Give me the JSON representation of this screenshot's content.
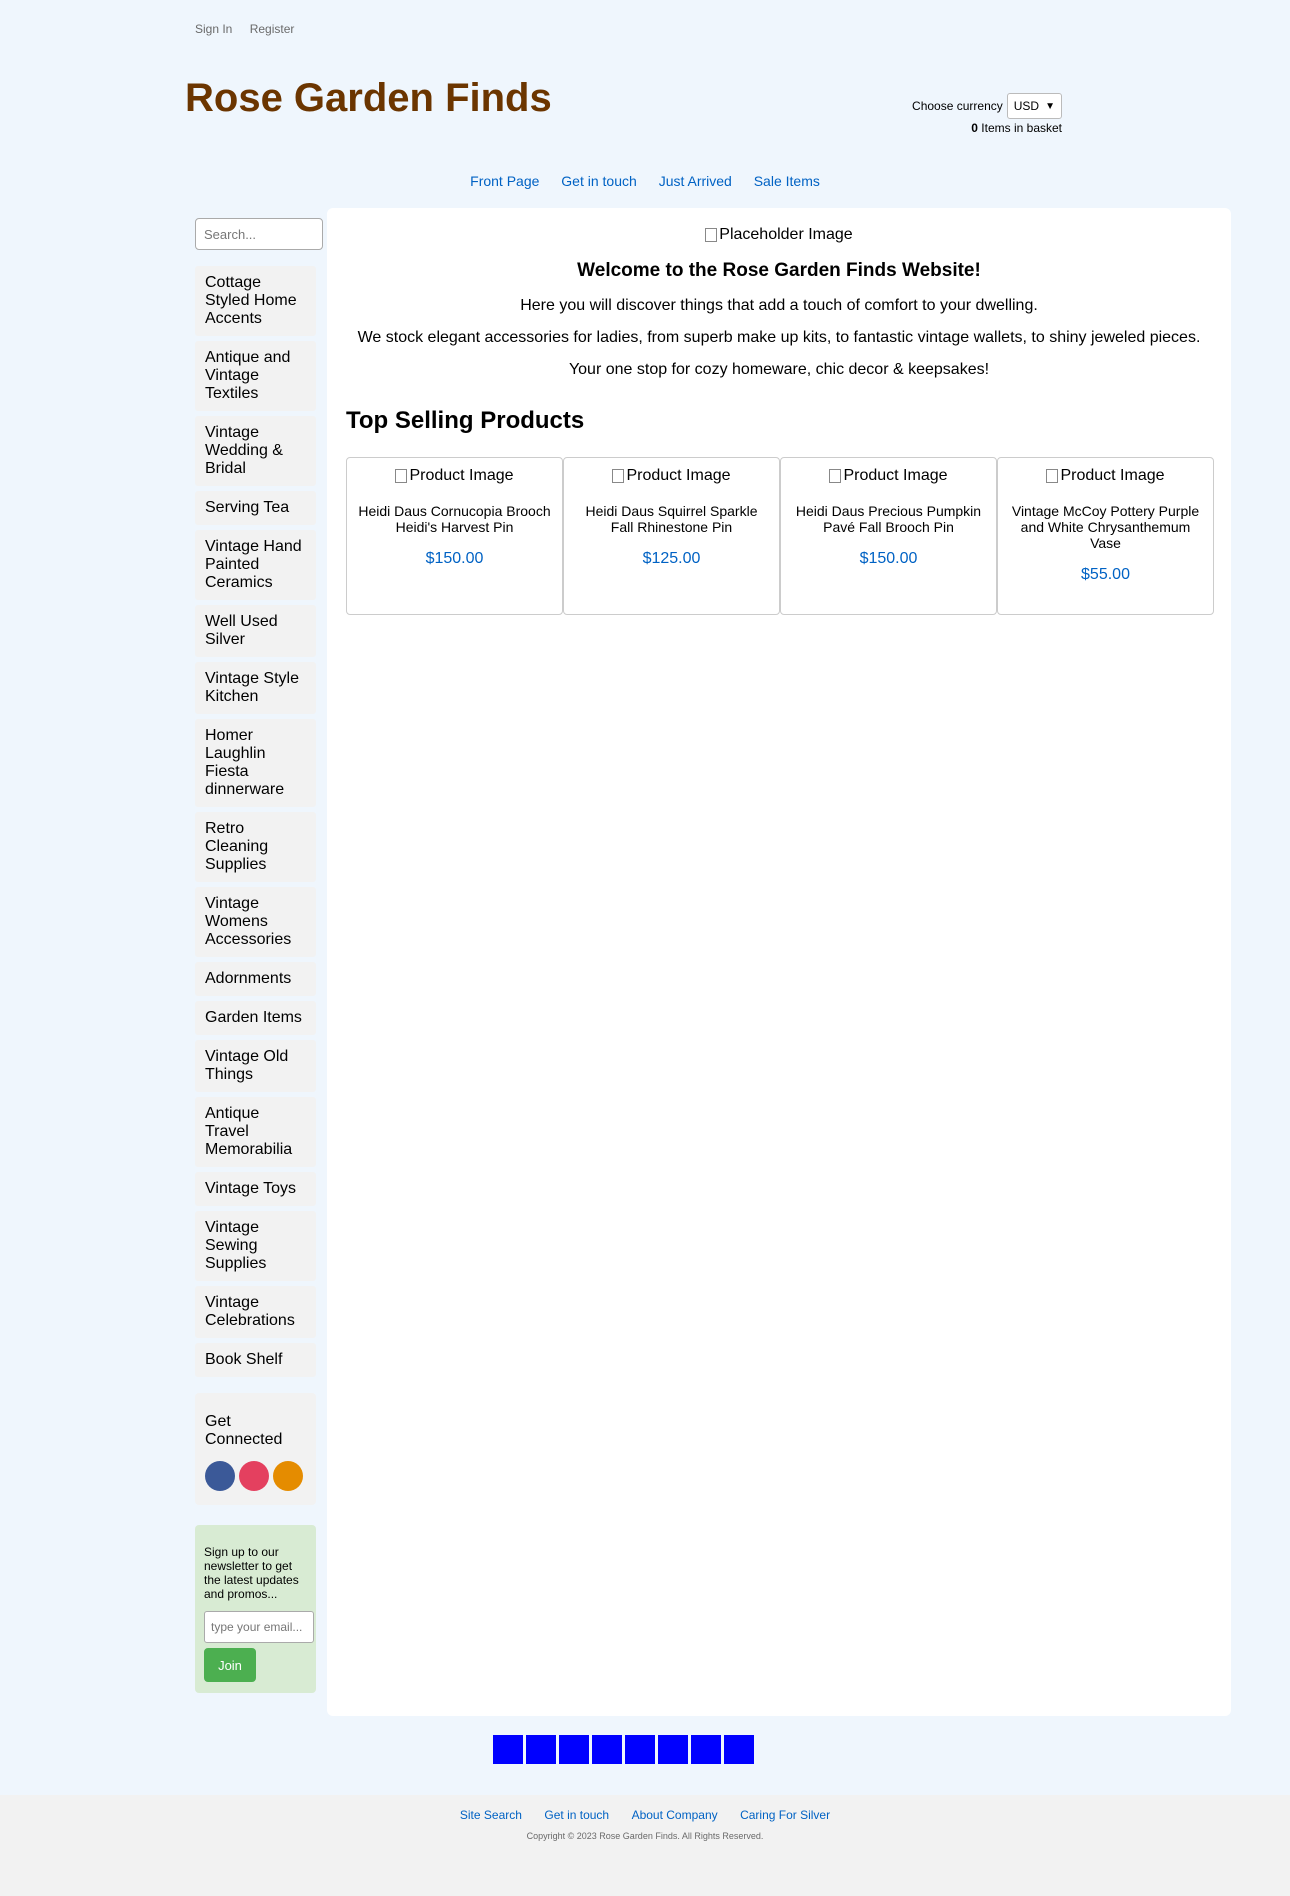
{
  "top_links": {
    "sign_in": "Sign In",
    "register": "Register"
  },
  "site": {
    "title": "Rose Garden Finds",
    "title_color": "#6b3500"
  },
  "currency": {
    "label": "Choose currency",
    "selected": "USD",
    "basket_count": "0",
    "basket_text": "Items in basket"
  },
  "nav": [
    "Front Page",
    "Get in touch",
    "Just Arrived",
    "Sale Items"
  ],
  "search": {
    "placeholder": "Search..."
  },
  "categories": [
    "Cottage Styled Home Accents",
    "Antique and Vintage Textiles",
    "Vintage Wedding & Bridal",
    "Serving Tea",
    "Vintage Hand Painted Ceramics",
    "Well Used Silver",
    "Vintage Style Kitchen",
    "Homer Laughlin Fiesta dinnerware",
    "Retro Cleaning Supplies",
    "Vintage Womens Accessories",
    "Adornments",
    "Garden Items",
    "Vintage Old Things",
    "Antique Travel Memorabilia",
    "Vintage Toys",
    "Vintage Sewing Supplies",
    "Vintage Celebrations",
    "Book Shelf"
  ],
  "connect": {
    "title": "Get Connected",
    "icons": [
      {
        "name": "facebook-icon",
        "color": "#3b5998"
      },
      {
        "name": "instagram-icon",
        "color": "#e4405f"
      },
      {
        "name": "rss-icon",
        "color": "#e58c00"
      }
    ]
  },
  "newsletter": {
    "text": "Sign up to our newsletter to get the latest updates and promos...",
    "placeholder": "type your email...",
    "button": "Join"
  },
  "main": {
    "hero_alt": "Placeholder Image",
    "welcome": "Welcome to the Rose Garden Finds Website!",
    "line1": "Here you will discover things that add a touch of comfort to your dwelling.",
    "line2": "We stock elegant accessories for ladies, from superb make up kits, to fantastic vintage wallets, to shiny jeweled pieces.",
    "line3": "Your one stop for cozy homeware, chic decor & keepsakes!",
    "top_heading": "Top Selling Products",
    "products": [
      {
        "img_alt": "Product Image",
        "name": "Heidi Daus Cornucopia Brooch Heidi's Harvest Pin",
        "price": "$150.00"
      },
      {
        "img_alt": "Product Image",
        "name": "Heidi Daus Squirrel Sparkle Fall Rhinestone Pin",
        "price": "$125.00"
      },
      {
        "img_alt": "Product Image",
        "name": "Heidi Daus Precious Pumpkin Pavé Fall Brooch Pin",
        "price": "$150.00"
      },
      {
        "img_alt": "Product Image",
        "name": "Vintage McCoy Pottery Purple and White Chrysanthemum Vase",
        "price": "$55.00"
      }
    ]
  },
  "pager_count": 8,
  "footer": {
    "links": [
      "Site Search",
      "Get in touch",
      "About Company",
      "Caring For Silver"
    ],
    "copyright": "Copyright © 2023 Rose Garden Finds. All Rights Reserved."
  }
}
